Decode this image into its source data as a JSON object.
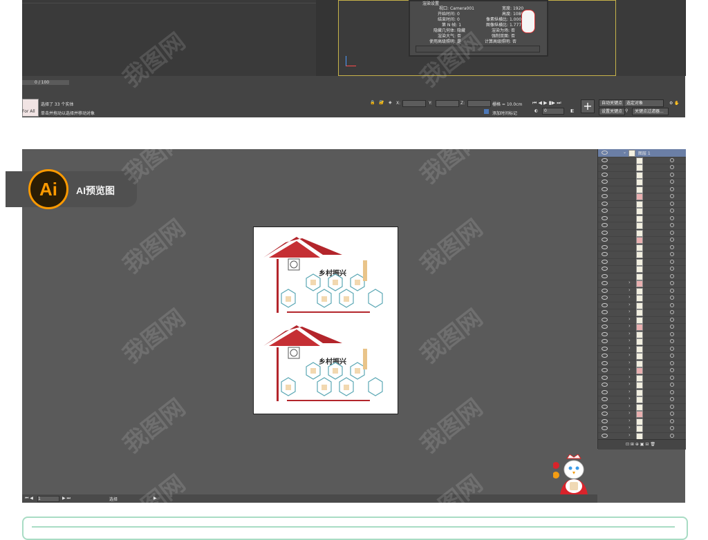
{
  "max": {
    "render_info": [
      {
        "label": "渲染设置",
        "value": ""
      },
      {
        "label": "视口:",
        "value": "Camera001",
        "label2": "宽度:",
        "value2": "1920"
      },
      {
        "label": "开始时间:",
        "value": "0",
        "label2": "高度:",
        "value2": "1080"
      },
      {
        "label": "结束时间:",
        "value": "0",
        "label2": "像素纵横比:",
        "value2": "1.00000"
      },
      {
        "label": "第 N 帧:",
        "value": "1",
        "label2": "图像纵横比:",
        "value2": "1.77778"
      },
      {
        "label": "隐藏几何体:",
        "value": "隐藏",
        "label2": "渲染为场:",
        "value2": "否"
      },
      {
        "label": "渲染大气:",
        "value": "否",
        "label2": "强制双面:",
        "value2": "否"
      },
      {
        "label": "使用高级照明:",
        "value": "是",
        "label2": "计算高级照明:",
        "value2": "否"
      }
    ],
    "timeslider": "0 / 100",
    "maxscript": "For All",
    "status_selected": "选择了 33 个实体",
    "status_prompt": "单击并拖动以选择并移动对象",
    "coord_x": "X:",
    "coord_y": "Y:",
    "coord_z": "Z:",
    "grid": "栅格 = 10.0cm",
    "add_time_tag": "添加时间标记",
    "auto_key": "自动关键点",
    "set_key": "设置关键点",
    "selected_object": "选定对象",
    "key_filter": "关键点过滤器...",
    "frame_value": "0"
  },
  "ai": {
    "badge_text": "AI预览图",
    "badge_logo": "Ai",
    "layer_name": "图层 1",
    "bottom_page": "1",
    "bottom_tool": "选择",
    "artboard_title": "乡村振兴"
  },
  "watermark": "我图网",
  "colors": {
    "accent_orange": "#ff9a00",
    "roof_red": "#b3252b",
    "frame_green": "#a8dcc4"
  }
}
